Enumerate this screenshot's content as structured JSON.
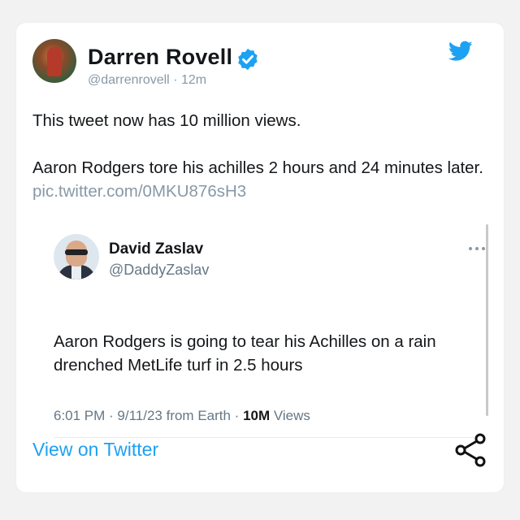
{
  "tweet": {
    "author": {
      "name": "Darren Rovell",
      "handle": "@darrenrovell",
      "time": "12m",
      "verified": true
    },
    "text_line1": "This tweet now has 10 million views.",
    "text_line2": "Aaron Rodgers tore his achilles 2 hours and 24 minutes later.",
    "pic_link": "pic.twitter.com/0MKU876sH3"
  },
  "quoted_tweet": {
    "author": {
      "name": "David Zaslav",
      "handle": "@DaddyZaslav"
    },
    "text": "Aaron Rodgers is going to tear his Achilles on a rain drenched MetLife turf in 2.5 hours",
    "meta_prefix": "6:01 PM · 9/11/23 from Earth · ",
    "views_count": "10M",
    "views_label": "Views"
  },
  "footer": {
    "view_on_twitter": "View on Twitter"
  },
  "icons": {
    "verified": "verified-badge-icon",
    "brand": "twitter-bird-icon",
    "more": "more-horizontal-icon",
    "share": "share-icon"
  },
  "colors": {
    "twitter_blue": "#1da1f2",
    "text": "#14171a",
    "secondary_text": "#657786"
  }
}
